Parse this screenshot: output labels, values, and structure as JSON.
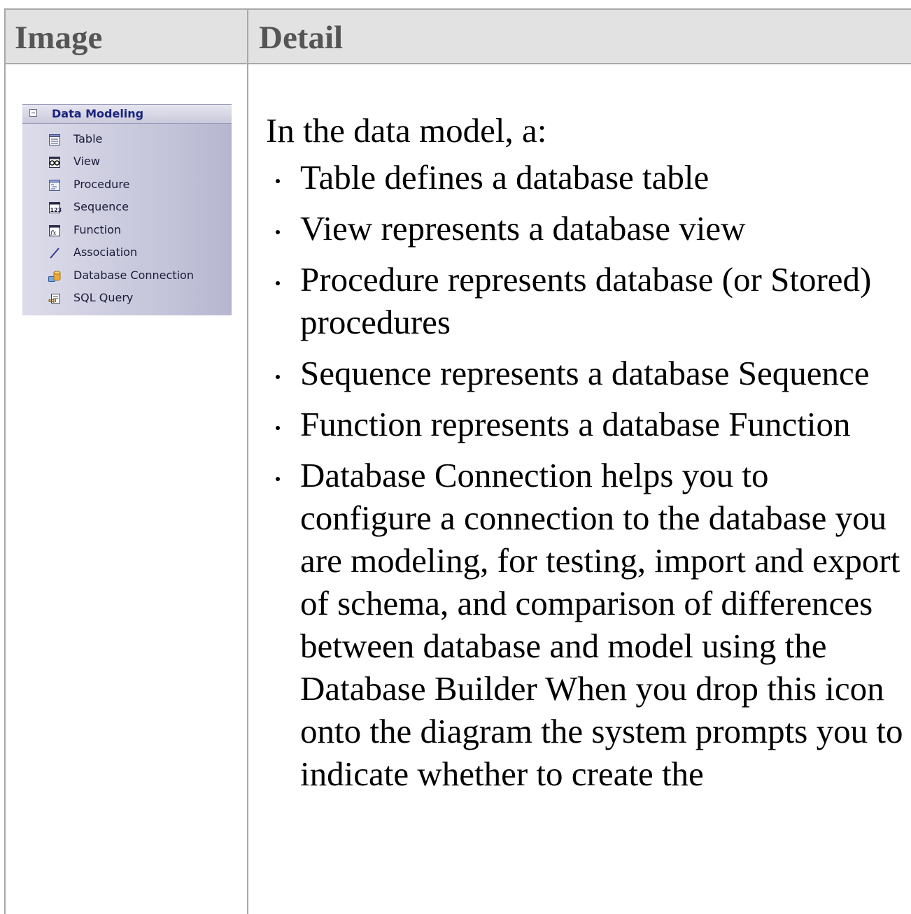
{
  "table": {
    "headers": {
      "image": "Image",
      "detail": "Detail"
    }
  },
  "toolbox": {
    "title": "Data Modeling",
    "items": [
      {
        "label": "Table",
        "icon": "table-icon"
      },
      {
        "label": "View",
        "icon": "view-icon"
      },
      {
        "label": "Procedure",
        "icon": "procedure-icon"
      },
      {
        "label": "Sequence",
        "icon": "sequence-icon"
      },
      {
        "label": "Function",
        "icon": "function-icon"
      },
      {
        "label": "Association",
        "icon": "association-icon"
      },
      {
        "label": "Database Connection",
        "icon": "database-connection-icon"
      },
      {
        "label": "SQL Query",
        "icon": "sql-query-icon"
      }
    ]
  },
  "detail": {
    "intro": "In the data model, a:",
    "bullets": [
      "Table defines a database table",
      "View represents a database view",
      "Procedure represents database (or Stored) procedures",
      "Sequence represents a database Sequence",
      "Function represents a database Function",
      "Database Connection helps you to configure a connection to the database you are modeling, for testing, import and export of schema, and comparison of differences between database and model using the Database Builder When you drop this icon onto the diagram the system prompts you to indicate whether to create the"
    ]
  }
}
